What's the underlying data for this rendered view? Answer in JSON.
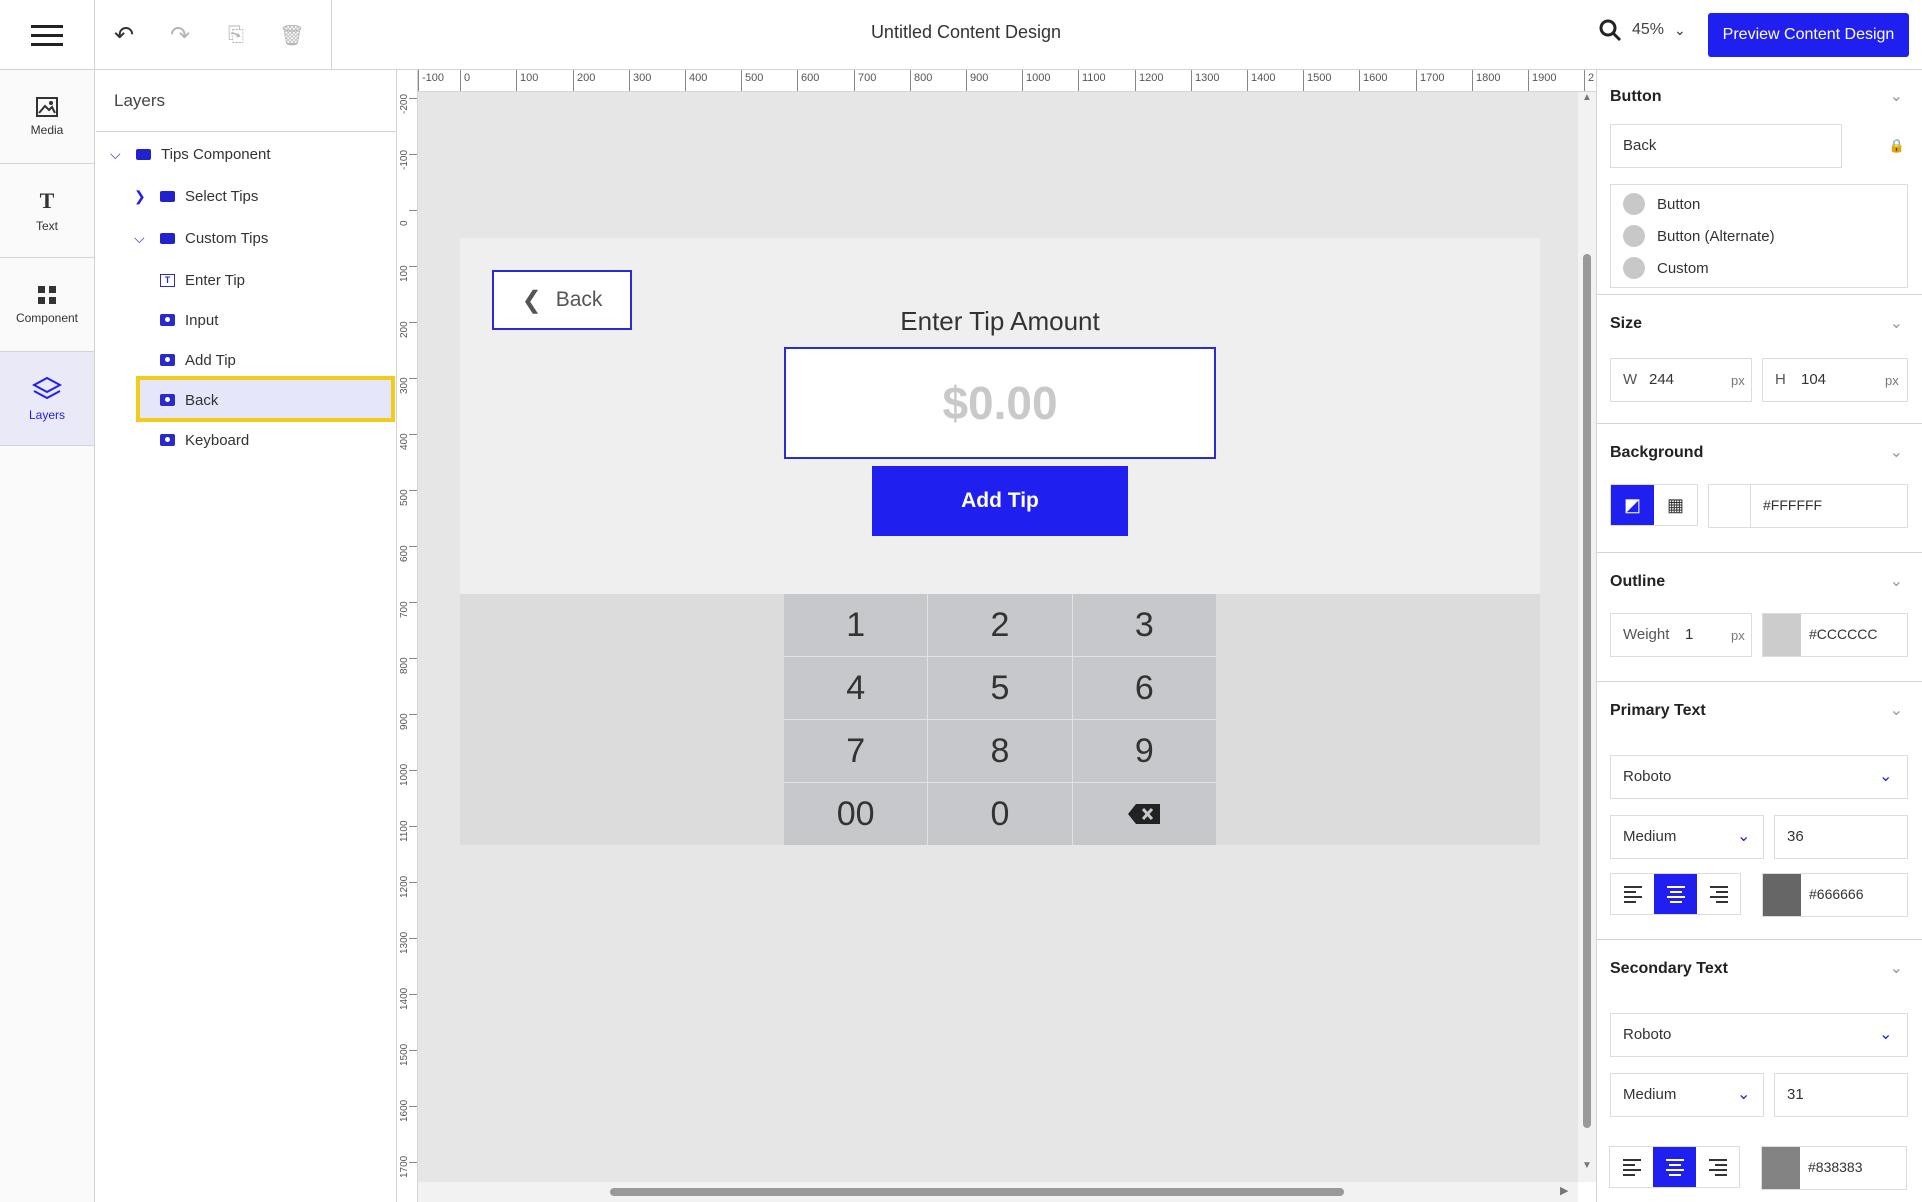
{
  "app": {
    "title": "Untitled Content Design",
    "zoom": "45%",
    "preview_label": "Preview Content Design"
  },
  "toolbar": {
    "undo_icon": "undo-icon",
    "redo_icon": "redo-icon",
    "duplicate_icon": "duplicate-icon",
    "delete_icon": "trash-icon"
  },
  "nav": {
    "items": [
      {
        "label": "Media",
        "icon": "image-icon"
      },
      {
        "label": "Text",
        "icon": "text-icon"
      },
      {
        "label": "Component",
        "icon": "component-icon"
      },
      {
        "label": "Layers",
        "icon": "layers-icon"
      }
    ]
  },
  "layers": {
    "title": "Layers",
    "items": [
      {
        "label": "Tips Component",
        "type": "folder",
        "expanded": true
      },
      {
        "label": "Select Tips",
        "type": "folder",
        "expanded": false
      },
      {
        "label": "Custom Tips",
        "type": "folder",
        "expanded": true
      },
      {
        "label": "Enter Tip",
        "type": "text"
      },
      {
        "label": "Input",
        "type": "component"
      },
      {
        "label": "Add Tip",
        "type": "component"
      },
      {
        "label": "Back",
        "type": "component",
        "selected": true
      },
      {
        "label": "Keyboard",
        "type": "component"
      }
    ]
  },
  "rulers": {
    "horizontal": [
      "-100",
      "0",
      "100",
      "200",
      "300",
      "400",
      "500",
      "600",
      "700",
      "800",
      "900",
      "1000",
      "1100",
      "1200",
      "1300",
      "1400",
      "1500",
      "1600",
      "1700",
      "1800",
      "1900",
      "2"
    ],
    "vertical": [
      "-200",
      "-100",
      "0",
      "100",
      "200",
      "300",
      "400",
      "500",
      "600",
      "700",
      "800",
      "900",
      "1000",
      "1100",
      "1200",
      "1300",
      "1400",
      "1500",
      "1600",
      "1700"
    ]
  },
  "canvas": {
    "back_label": "Back",
    "heading": "Enter Tip Amount",
    "input_placeholder": "$0.00",
    "add_tip_label": "Add Tip",
    "keys": [
      "1",
      "2",
      "3",
      "4",
      "5",
      "6",
      "7",
      "8",
      "9",
      "00",
      "0",
      "backspace-icon"
    ]
  },
  "properties": {
    "button": {
      "header": "Button",
      "name_value": "Back",
      "styles": [
        "Button",
        "Button (Alternate)",
        "Custom"
      ]
    },
    "size": {
      "header": "Size",
      "w_label": "W",
      "w_value": "244",
      "w_unit": "px",
      "h_label": "H",
      "h_value": "104",
      "h_unit": "px"
    },
    "background": {
      "header": "Background",
      "color": "#FFFFFF"
    },
    "outline": {
      "header": "Outline",
      "weight_label": "Weight",
      "weight_value": "1",
      "weight_unit": "px",
      "color": "#CCCCCC"
    },
    "primary_text": {
      "header": "Primary Text",
      "font": "Roboto",
      "weight": "Medium",
      "size": "36",
      "color": "#666666",
      "align": "center"
    },
    "secondary_text": {
      "header": "Secondary Text",
      "font": "Roboto",
      "weight": "Medium",
      "size": "31",
      "color": "#838383",
      "align": "center"
    }
  },
  "colors": {
    "accent": "#1f1fef",
    "highlight": "#f2cc1d"
  }
}
